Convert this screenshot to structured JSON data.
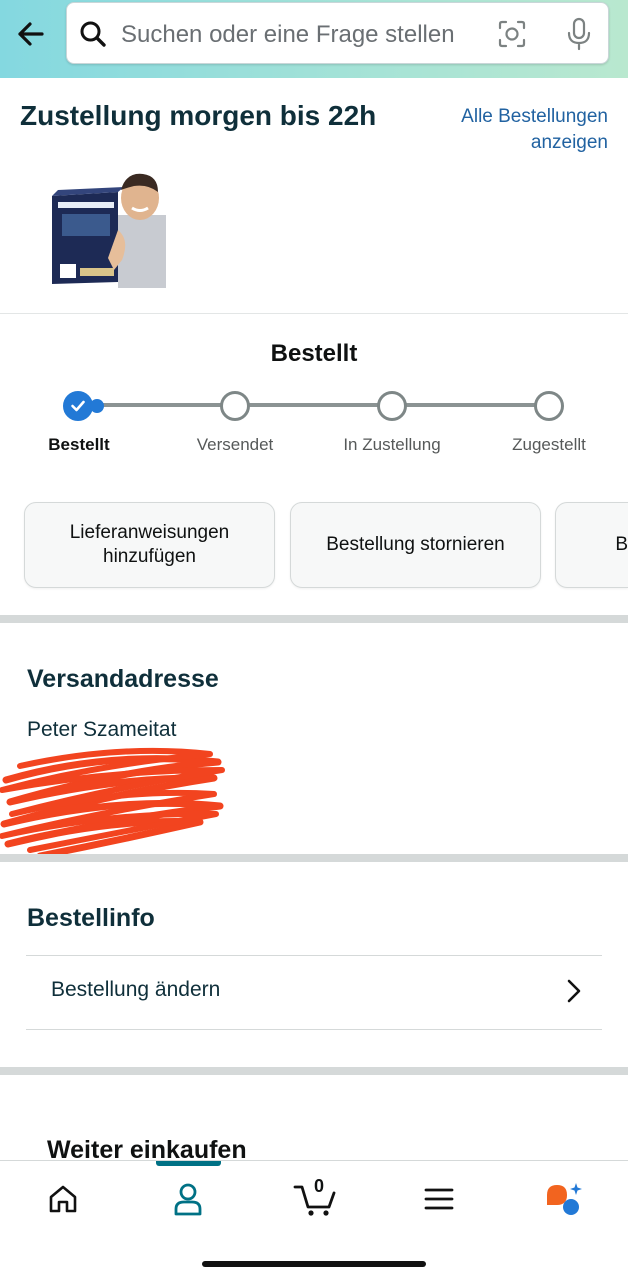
{
  "search": {
    "placeholder": "Suchen oder eine Frage stellen"
  },
  "delivery": {
    "title": "Zustellung morgen bis 22h",
    "all_orders_link": "Alle Bestellungen anzeigen",
    "product_image": "nasal-strips-product"
  },
  "status": {
    "title": "Bestellt",
    "steps": [
      {
        "label": "Bestellt",
        "done": true
      },
      {
        "label": "Versendet",
        "done": false
      },
      {
        "label": "In Zustellung",
        "done": false
      },
      {
        "label": "Zugestellt",
        "done": false
      }
    ]
  },
  "actions": [
    {
      "label": "Lieferanweisungen hinzufügen"
    },
    {
      "label": "Bestellung stornieren"
    },
    {
      "label": "B"
    }
  ],
  "address": {
    "title": "Versandadresse",
    "name": "Peter Szameitat",
    "line1": "",
    "line2": ""
  },
  "order_info": {
    "title": "Bestellinfo",
    "change_order": "Bestellung ändern"
  },
  "shop_more": "Weiter einkaufen",
  "bottom_nav": {
    "cart_count": "0",
    "items": [
      "home-icon",
      "profile-icon",
      "cart-icon",
      "menu-icon",
      "rufus-ai-icon"
    ]
  },
  "colors": {
    "accent_blue": "#2279d6",
    "link": "#2162a1",
    "teal": "#007185",
    "redaction": "#f2441f"
  }
}
